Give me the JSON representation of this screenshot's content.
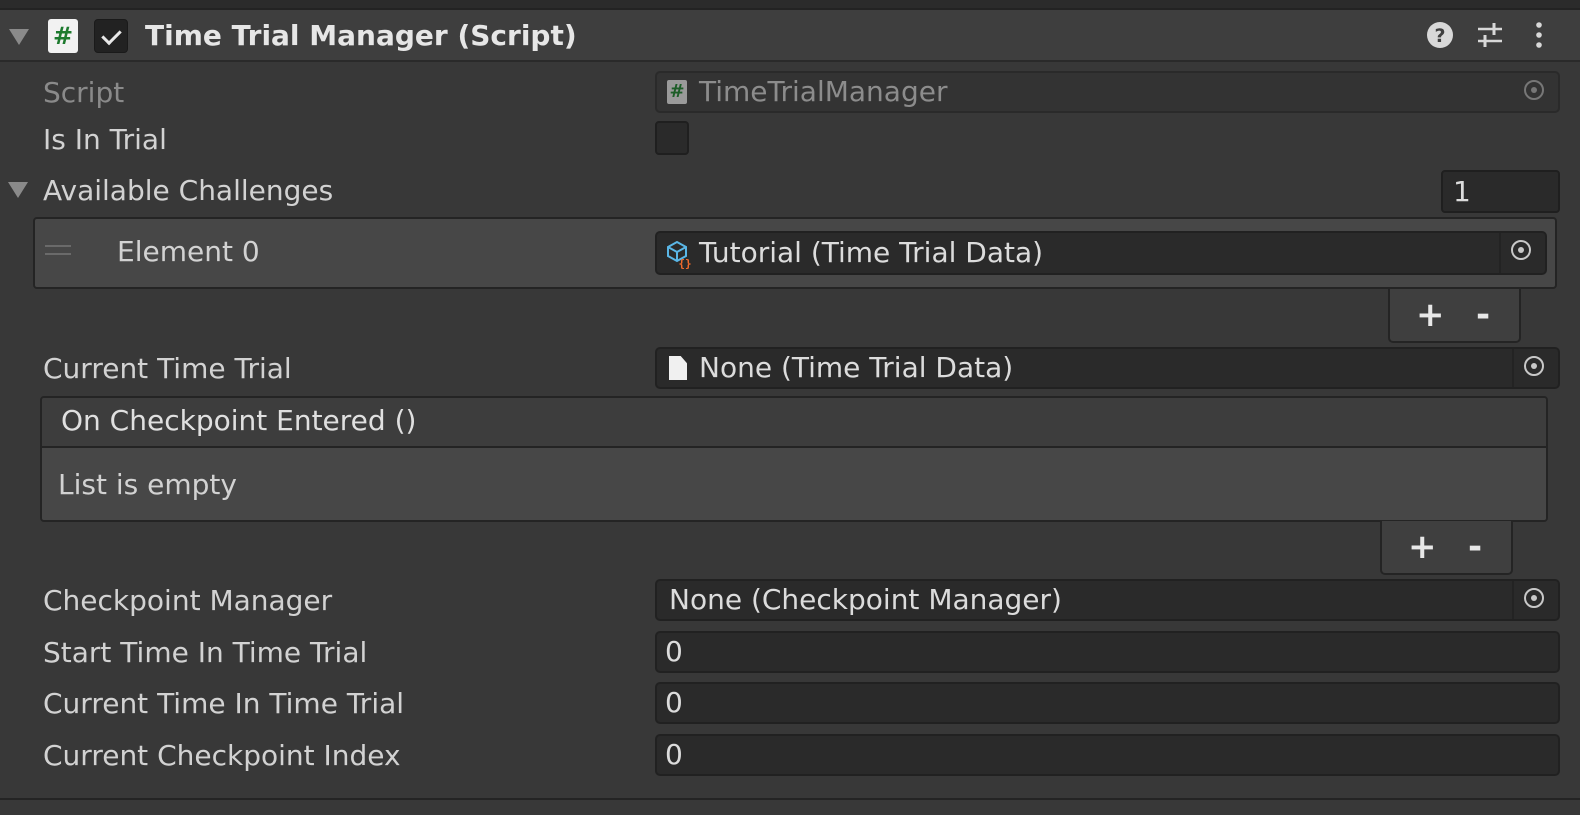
{
  "header": {
    "title": "Time Trial Manager (Script)",
    "enabled": true,
    "icons": [
      "script-icon",
      "help-icon",
      "presets-icon",
      "kebab-menu-icon"
    ]
  },
  "fields": {
    "script": {
      "label": "Script",
      "value": "TimeTrialManager"
    },
    "is_in_trial": {
      "label": "Is In Trial",
      "checked": false
    },
    "available_challenges": {
      "label": "Available Challenges",
      "size": "1",
      "elements": [
        {
          "label": "Element 0",
          "value": "Tutorial (Time Trial Data)"
        }
      ],
      "add_label": "+",
      "remove_label": "-"
    },
    "current_time_trial": {
      "label": "Current Time Trial",
      "value": "None (Time Trial Data)"
    },
    "on_checkpoint_entered": {
      "label": "On Checkpoint Entered ()",
      "empty_text": "List is empty",
      "add_label": "+",
      "remove_label": "-"
    },
    "checkpoint_manager": {
      "label": "Checkpoint Manager",
      "value": "None (Checkpoint Manager)"
    },
    "start_time": {
      "label": "Start Time In Time Trial",
      "value": "0"
    },
    "current_time": {
      "label": "Current Time In Time Trial",
      "value": "0"
    },
    "checkpoint_index": {
      "label": "Current Checkpoint Index",
      "value": "0"
    }
  },
  "colors": {
    "background": "#383838",
    "field_background": "#2a2a2a",
    "script_green": "#1d7a2e",
    "asset_icon_blue": "#5ab6e6",
    "asset_icon_orange": "#f06a2c"
  }
}
